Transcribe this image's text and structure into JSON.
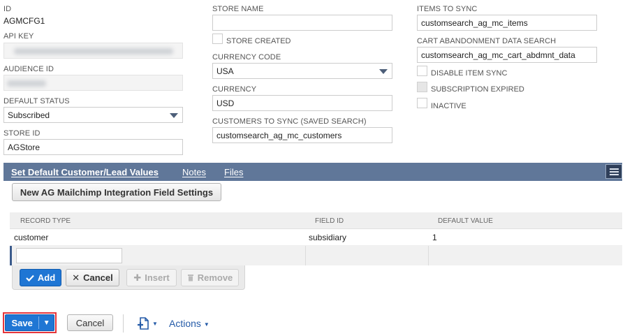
{
  "colors": {
    "tab_bar": "#607799",
    "primary_button": "#1f76d4",
    "highlight_border": "#e5353b",
    "link": "#255ba8"
  },
  "col1": {
    "id_label": "ID",
    "id_value": "AGMCFG1",
    "api_key_label": "API KEY",
    "audience_id_label": "AUDIENCE ID",
    "default_status_label": "DEFAULT STATUS",
    "default_status_value": "Subscribed",
    "store_id_label": "STORE ID",
    "store_id_value": "AGStore"
  },
  "col2": {
    "store_name_label": "STORE NAME",
    "store_name_value": "",
    "store_created_label": "STORE CREATED",
    "currency_code_label": "CURRENCY CODE",
    "currency_code_value": "USA",
    "currency_label": "CURRENCY",
    "currency_value": "USD",
    "customers_to_sync_label": "CUSTOMERS TO SYNC (SAVED SEARCH)",
    "customers_to_sync_value": "customsearch_ag_mc_customers"
  },
  "col3": {
    "items_to_sync_label": "ITEMS TO SYNC",
    "items_to_sync_value": "customsearch_ag_mc_items",
    "cart_abandonment_label": "CART ABANDONMENT DATA SEARCH",
    "cart_abandonment_value": "customsearch_ag_mc_cart_abdmnt_data",
    "disable_item_sync_label": "DISABLE ITEM SYNC",
    "subscription_expired_label": "SUBSCRIPTION EXPIRED",
    "inactive_label": "INACTIVE"
  },
  "tabs": [
    "Set Default Customer/Lead Values",
    "Notes",
    "Files"
  ],
  "sublist": {
    "new_button": "New AG Mailchimp Integration Field Settings",
    "columns": [
      "RECORD TYPE",
      "FIELD ID",
      "DEFAULT VALUE"
    ],
    "rows": [
      {
        "record_type": "customer",
        "field_id": "subsidiary",
        "default_value": "1"
      }
    ],
    "edit_buttons": {
      "add": "Add",
      "cancel": "Cancel",
      "insert": "Insert",
      "remove": "Remove"
    }
  },
  "footer": {
    "save": "Save",
    "cancel": "Cancel",
    "actions": "Actions"
  }
}
